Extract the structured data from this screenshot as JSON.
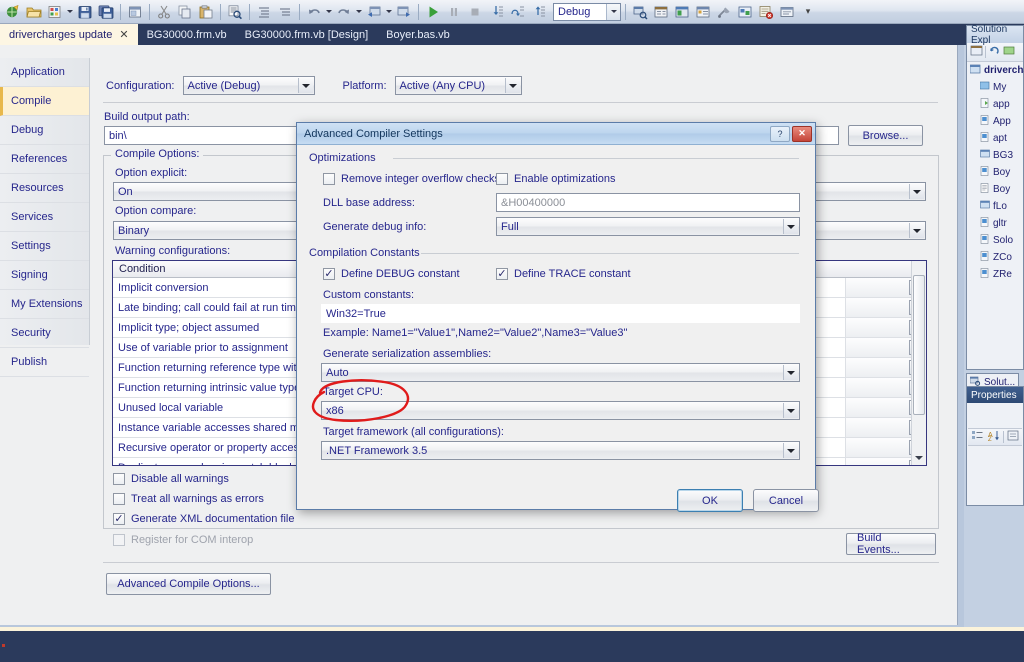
{
  "toolbar": {
    "icons": [
      "new-project-icon",
      "open-file-icon",
      "add-new-item-icon",
      "save-icon",
      "save-all-icon",
      "toggle-window-icon",
      "cut-icon",
      "copy-icon",
      "paste-icon",
      "find-icon",
      "comment-icon",
      "uncomment-icon",
      "undo-icon",
      "redo-icon",
      "navigate-backward-icon",
      "navigate-forward-icon"
    ],
    "config_value": "Debug",
    "right_icons": [
      "solution-explorer-icon",
      "properties-window-icon",
      "toolbox-icon",
      "object-browser-icon",
      "tools-icon",
      "class-view-icon",
      "error-list-icon",
      "output-window-icon",
      "toolbar-overflow-icon"
    ]
  },
  "tabs": [
    {
      "label": "drivercharges update",
      "active": true,
      "closable": true
    },
    {
      "label": "BG30000.frm.vb",
      "active": false,
      "closable": false
    },
    {
      "label": "BG30000.frm.vb [Design]",
      "active": false,
      "closable": false
    },
    {
      "label": "Boyer.bas.vb",
      "active": false,
      "closable": false
    }
  ],
  "categories": [
    {
      "label": "Application",
      "selected": false
    },
    {
      "label": "Compile",
      "selected": true
    },
    {
      "label": "Debug",
      "selected": false
    },
    {
      "label": "References",
      "selected": false
    },
    {
      "label": "Resources",
      "selected": false
    },
    {
      "label": "Services",
      "selected": false
    },
    {
      "label": "Settings",
      "selected": false
    },
    {
      "label": "Signing",
      "selected": false
    },
    {
      "label": "My Extensions",
      "selected": false
    },
    {
      "label": "Security",
      "selected": false
    },
    {
      "label": "Publish",
      "selected": false
    }
  ],
  "compile_page": {
    "configuration_label": "Configuration:",
    "configuration_value": "Active (Debug)",
    "platform_label": "Platform:",
    "platform_value": "Active (Any CPU)",
    "build_output_label": "Build output path:",
    "build_output_value": "bin\\",
    "browse_label": "Browse...",
    "compile_options_label": "Compile Options:",
    "option_explicit_label": "Option explicit:",
    "option_explicit_value": "On",
    "option_compare_label": "Option compare:",
    "option_compare_value": "Binary",
    "warning_configurations_label": "Warning configurations:",
    "grid_header_condition": "Condition",
    "grid_rows": [
      "Implicit conversion",
      "Late binding; call could fail at run time",
      "Implicit type; object assumed",
      "Use of variable prior to assignment",
      "Function returning reference type without r",
      "Function returning intrinsic value type with",
      "Unused local variable",
      "Instance variable accesses shared member",
      "Recursive operator or property access",
      "Duplicate or overlapping catch blocks"
    ],
    "checkboxes": [
      {
        "label": "Disable all warnings",
        "checked": false,
        "disabled": false
      },
      {
        "label": "Treat all warnings as errors",
        "checked": false,
        "disabled": false
      },
      {
        "label": "Generate XML documentation file",
        "checked": true,
        "disabled": false
      },
      {
        "label": "Register for COM interop",
        "checked": false,
        "disabled": true
      }
    ],
    "advanced_button": "Advanced Compile Options...",
    "build_events_button": "Build Events..."
  },
  "dialog": {
    "title": "Advanced Compiler Settings",
    "help_button": "?",
    "close_button": "✕",
    "optimizations_group": "Optimizations",
    "remove_overflow_label": "Remove integer overflow checks",
    "remove_overflow_checked": false,
    "enable_optimizations_label": "Enable optimizations",
    "enable_optimizations_checked": false,
    "dll_base_label": "DLL base address:",
    "dll_base_value": "&H00400000",
    "debug_info_label": "Generate debug info:",
    "debug_info_value": "Full",
    "compilation_constants_group": "Compilation Constants",
    "define_debug_label": "Define DEBUG constant",
    "define_debug_checked": true,
    "define_trace_label": "Define TRACE constant",
    "define_trace_checked": true,
    "custom_constants_label": "Custom constants:",
    "custom_constants_value": "Win32=True",
    "example_text": "Example: Name1=\"Value1\",Name2=\"Value2\",Name3=\"Value3\"",
    "serialization_label": "Generate serialization assemblies:",
    "serialization_value": "Auto",
    "target_cpu_label": "Target CPU:",
    "target_cpu_value": "x86",
    "target_framework_label": "Target framework (all configurations):",
    "target_framework_value": ".NET Framework 3.5",
    "ok_label": "OK",
    "cancel_label": "Cancel"
  },
  "annotation": {
    "color": "#e01b1b",
    "shape": "hand-drawn-ellipse",
    "target": "Target CPU: x86"
  },
  "solution_explorer": {
    "title": "Solution Expl",
    "root": "drivercha",
    "items": [
      {
        "label": "My",
        "icon": "my-project-icon"
      },
      {
        "label": "app",
        "icon": "config-file-icon"
      },
      {
        "label": "App",
        "icon": "vb-file-icon"
      },
      {
        "label": "apt",
        "icon": "vb-file-icon"
      },
      {
        "label": "BG3",
        "icon": "form-icon"
      },
      {
        "label": "Boy",
        "icon": "vb-file-icon"
      },
      {
        "label": "Boy",
        "icon": "module-icon"
      },
      {
        "label": "fLo",
        "icon": "form-icon"
      },
      {
        "label": "gltr",
        "icon": "vb-file-icon"
      },
      {
        "label": "Solo",
        "icon": "vb-file-icon"
      },
      {
        "label": "ZCo",
        "icon": "vb-file-icon"
      },
      {
        "label": "ZRe",
        "icon": "vb-file-icon"
      }
    ],
    "tab_label": "Solut...",
    "toolbar_icons": [
      "properties-icon",
      "refresh-icon",
      "show-all-files-icon"
    ]
  },
  "properties_panel": {
    "title": "Properties",
    "toolbar_icons": [
      "categorized-icon",
      "alphabetical-icon",
      "properties-page-icon"
    ]
  }
}
